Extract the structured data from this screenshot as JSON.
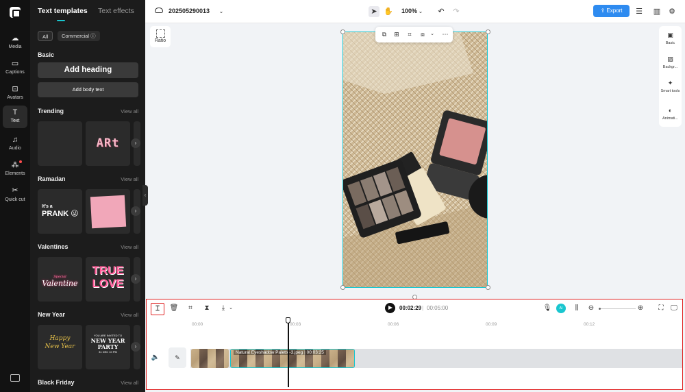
{
  "rail": {
    "items": [
      {
        "label": "Media",
        "icon": "media-icon"
      },
      {
        "label": "Captions",
        "icon": "captions-icon"
      },
      {
        "label": "Avatars",
        "icon": "avatars-icon"
      },
      {
        "label": "Text",
        "icon": "text-icon",
        "active": true
      },
      {
        "label": "Audio",
        "icon": "audio-icon"
      },
      {
        "label": "Elements",
        "icon": "elements-icon"
      },
      {
        "label": "Quick cut",
        "icon": "quick-cut-icon"
      }
    ]
  },
  "panel": {
    "tabs": [
      "Text templates",
      "Text effects"
    ],
    "chips": [
      "All",
      "Commercial ⓘ"
    ],
    "basic": {
      "title": "Basic",
      "heading_btn": "Add heading",
      "body_btn": "Add body text"
    },
    "sections": [
      {
        "title": "Trending",
        "view_all": "View all",
        "tiles": [
          "",
          "ARt"
        ]
      },
      {
        "title": "Ramadan",
        "view_all": "View all",
        "tiles": [
          "PRANK",
          "note"
        ]
      },
      {
        "title": "Valentines",
        "view_all": "View all",
        "tiles": [
          "Valentine",
          "TRUE LOVE"
        ]
      },
      {
        "title": "New Year",
        "view_all": "View all",
        "tiles": [
          "Happy New Year",
          "NEW YEAR PARTY"
        ]
      },
      {
        "title": "Black Friday",
        "view_all": "View all"
      }
    ],
    "tile_text": {
      "art": "ARt",
      "prank_small": "It's a",
      "prank_big": "PRANK 😜",
      "valentine_small": "Special",
      "valentine": "Valentine",
      "true": "TRUE",
      "love": "LOVE",
      "hny1": "Happy",
      "hny2": "New Year",
      "party_small": "YOU ARE INVITED TO",
      "party_big": "NEW YEAR PARTY",
      "party_date": "31 DEC 10 PM"
    }
  },
  "topbar": {
    "project_name": "202505290013",
    "zoom": "100%",
    "export": "Export"
  },
  "canvas": {
    "ratio_label": "Ratio"
  },
  "right_tools": [
    "Basic",
    "Backgr...",
    "Smart tools",
    "Animati..."
  ],
  "timeline": {
    "current_time": "00:02:29",
    "separator": "|",
    "total_time": "00:05:00",
    "ruler": [
      "00:00",
      "00:03",
      "00:06",
      "00:09",
      "00:12"
    ],
    "clip_label": "Natural Eyeshadow Palette-3.jpeg | 00:03:25"
  },
  "colors": {
    "accent": "#19c6cf",
    "export": "#2e8bf0",
    "highlight": "#e02020"
  }
}
